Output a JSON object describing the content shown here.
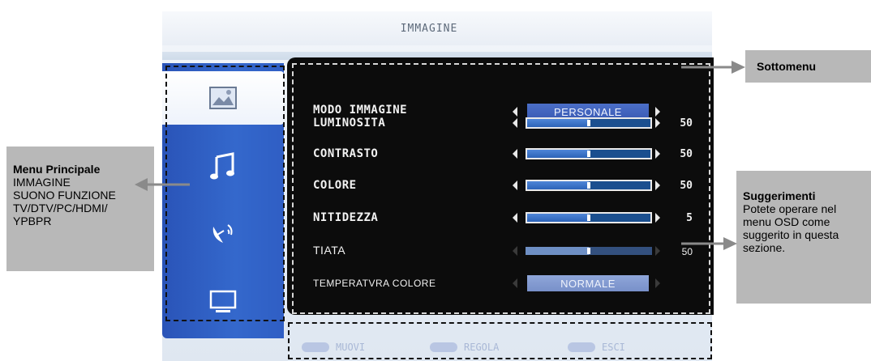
{
  "osd": {
    "title": "IMMAGINE",
    "sidebar": [
      {
        "icon": "picture-icon",
        "active": true
      },
      {
        "icon": "music-note-icon",
        "active": false
      },
      {
        "icon": "satellite-dish-icon",
        "active": false
      },
      {
        "icon": "monitor-icon",
        "active": false
      }
    ],
    "rows": {
      "modo_immagine": {
        "label": "MODO IMMAGINE",
        "value": "PERSONALE"
      },
      "luminosita": {
        "label": "LUMINOSITA",
        "level": 0.5,
        "value": "50"
      },
      "contrasto": {
        "label": "CONTRASTO",
        "level": 0.5,
        "value": "50"
      },
      "colore": {
        "label": "COLORE",
        "level": 0.5,
        "value": "50"
      },
      "nitidezza": {
        "label": "NITIDEZZA",
        "level": 0.5,
        "value": "5"
      },
      "tiata": {
        "label": "TIATA",
        "level": 0.5,
        "value": "50"
      },
      "temperatura": {
        "label": "TEMPERATVRA COLORE",
        "value": "NORMALE"
      }
    },
    "hints": [
      {
        "label": "MUOVI"
      },
      {
        "label": "REGOLA"
      },
      {
        "label": "ESCI"
      }
    ]
  },
  "callouts": {
    "sottomenu": "Sottomenu",
    "menu_principale": {
      "heading": "Menu Principale",
      "line1": "IMMAGINE",
      "line2": "SUONO FUNZIONE",
      "line3": "TV/DTV/PC/HDMI/",
      "line4": "YPBPR"
    },
    "suggerimenti": {
      "heading": "Suggerimenti",
      "line1": "Potete operare nel",
      "line2": "menu OSD come",
      "line3": "suggerito in questa",
      "line4": "sezione."
    }
  },
  "colors": {
    "sidebar_blue": "#3066c8",
    "panel_black": "#0c0c0c",
    "callout_grey": "#b8b8b8",
    "arrow_grey": "#8a8a8a"
  }
}
